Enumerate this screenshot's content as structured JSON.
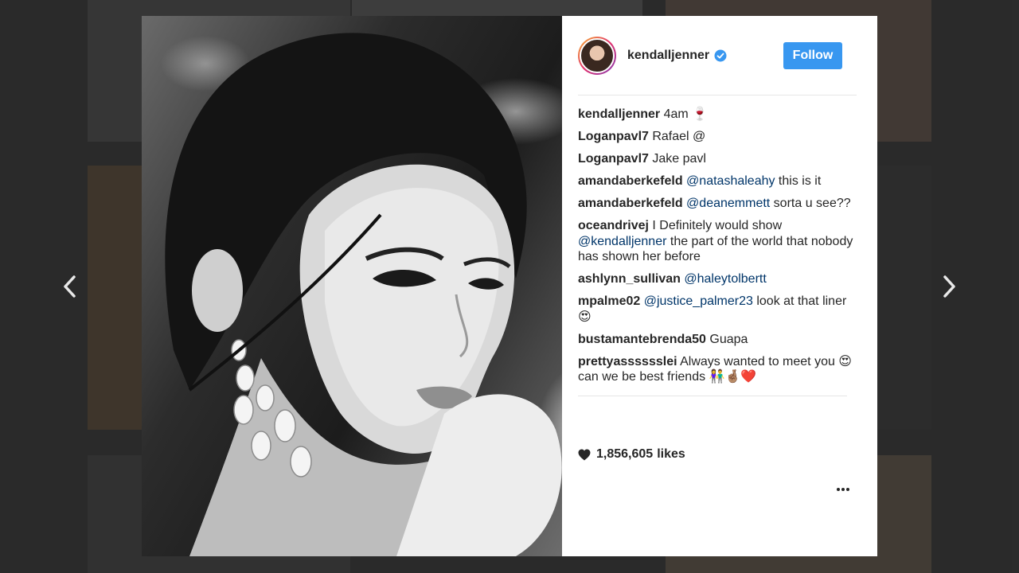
{
  "post": {
    "username": "kendalljenner",
    "follow_label": "Follow",
    "likes_count": "1,856,605",
    "likes_label": "likes"
  },
  "comments": [
    {
      "author": "kendalljenner",
      "text": " 4am 🍷"
    },
    {
      "author": "Loganpavl7",
      "text": " Rafael @"
    },
    {
      "author": "Loganpavl7",
      "text": " Jake pavl"
    },
    {
      "author": "amandaberkefeld",
      "mention": " @natashaleahy",
      "text": " this is it"
    },
    {
      "author": "amandaberkefeld",
      "mention": " @deanemmett",
      "text": " sorta u see??"
    },
    {
      "author": "oceandrivej",
      "text": " I Definitely would show ",
      "mention": "@kendalljenner",
      "text2": " the part of the world that nobody has shown her before"
    },
    {
      "author": "ashlynn_sullivan",
      "mention": " @haleytolbertt",
      "text": ""
    },
    {
      "author": "mpalme02",
      "mention": " @justice_palmer23",
      "text": " look at that liner 😍"
    },
    {
      "author": "bustamantebrenda50",
      "text": " Guapa"
    },
    {
      "author": "prettyasssssslei",
      "text": " Always wanted to meet you 😍 can we be best friends 👫🤞🏽❤️"
    }
  ],
  "colors": {
    "accent": "#3897f0",
    "mention": "#003569",
    "text": "#262626"
  },
  "icons": {
    "prev": "chevron-left-icon",
    "next": "chevron-right-icon",
    "verified": "verified-badge-icon",
    "heart": "heart-icon",
    "more": "more-options-icon"
  }
}
